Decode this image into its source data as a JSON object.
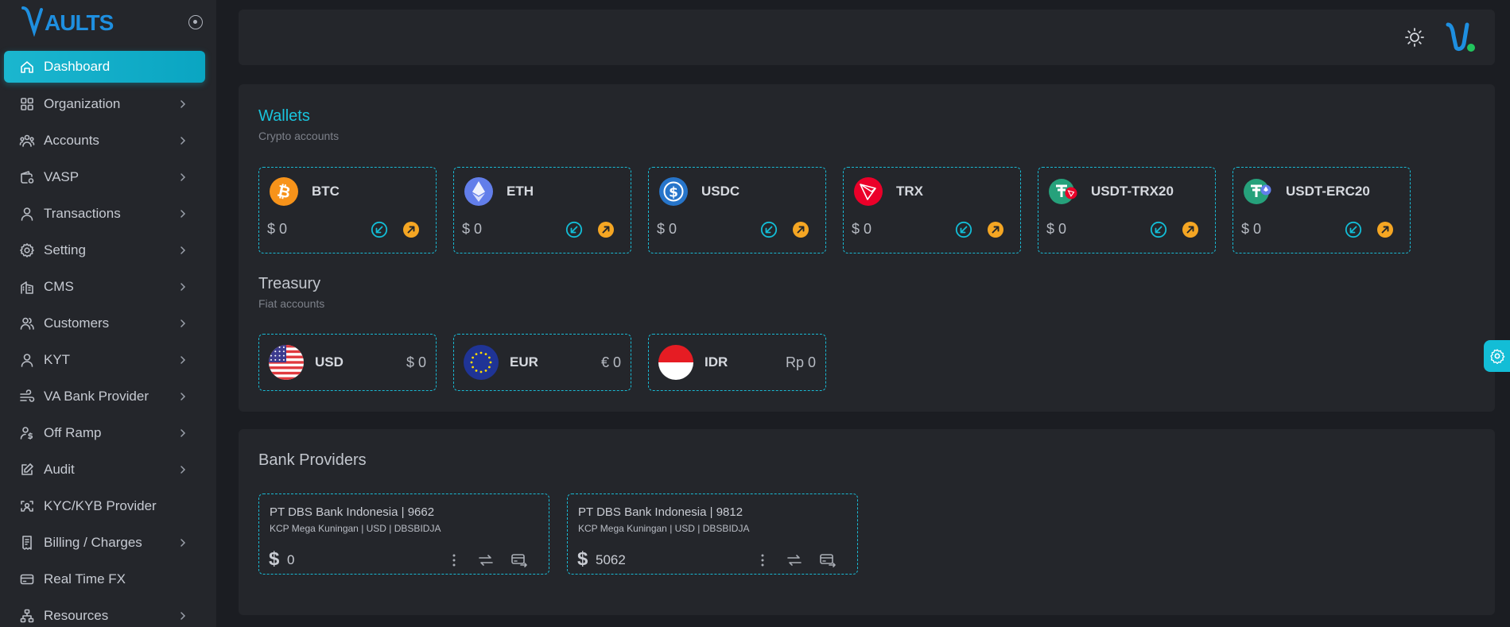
{
  "brand": {
    "logo_text": "VAULTS"
  },
  "sidebar": {
    "items": [
      {
        "label": "Dashboard",
        "icon": "home-icon",
        "active": true,
        "has_children": false
      },
      {
        "label": "Organization",
        "icon": "grid-icon",
        "has_children": true
      },
      {
        "label": "Accounts",
        "icon": "users-group-icon",
        "has_children": true
      },
      {
        "label": "VASP",
        "icon": "wallet-gear-icon",
        "has_children": true
      },
      {
        "label": "Transactions",
        "icon": "user-icon",
        "has_children": true
      },
      {
        "label": "Setting",
        "icon": "gear-icon",
        "has_children": true
      },
      {
        "label": "CMS",
        "icon": "building-icon",
        "has_children": true
      },
      {
        "label": "Customers",
        "icon": "users-icon",
        "has_children": true
      },
      {
        "label": "KYT",
        "icon": "user-outline-icon",
        "has_children": true
      },
      {
        "label": "VA Bank Provider",
        "icon": "wind-icon",
        "has_children": true
      },
      {
        "label": "Off Ramp",
        "icon": "user-dollar-icon",
        "has_children": true
      },
      {
        "label": "Audit",
        "icon": "edit-icon",
        "has_children": true
      },
      {
        "label": "KYC/KYB Provider",
        "icon": "face-scan-icon",
        "has_children": false
      },
      {
        "label": "Billing / Charges",
        "icon": "receipt-icon",
        "has_children": true
      },
      {
        "label": "Real Time FX",
        "icon": "credit-card-icon",
        "has_children": false
      },
      {
        "label": "Resources",
        "icon": "network-icon",
        "has_children": true
      }
    ]
  },
  "wallets": {
    "title": "Wallets",
    "subtitle": "Crypto accounts",
    "items": [
      {
        "symbol": "BTC",
        "amount": "$ 0",
        "icon": "btc-icon"
      },
      {
        "symbol": "ETH",
        "amount": "$ 0",
        "icon": "eth-icon"
      },
      {
        "symbol": "USDC",
        "amount": "$ 0",
        "icon": "usdc-icon"
      },
      {
        "symbol": "TRX",
        "amount": "$ 0",
        "icon": "trx-icon"
      },
      {
        "symbol": "USDT-TRX20",
        "amount": "$ 0",
        "icon": "usdt-trx20-icon"
      },
      {
        "symbol": "USDT-ERC20",
        "amount": "$ 0",
        "icon": "usdt-erc20-icon"
      }
    ]
  },
  "treasury": {
    "title": "Treasury",
    "subtitle": "Fiat accounts",
    "items": [
      {
        "symbol": "USD",
        "amount": "$ 0",
        "icon": "us-flag-icon"
      },
      {
        "symbol": "EUR",
        "amount": "€ 0",
        "icon": "eu-flag-icon"
      },
      {
        "symbol": "IDR",
        "amount": "Rp 0",
        "icon": "id-flag-icon"
      }
    ]
  },
  "banks": {
    "title": "Bank Providers",
    "items": [
      {
        "name": "PT DBS Bank Indonesia | 9662",
        "detail": "KCP Mega Kuningan | USD | DBSBIDJA",
        "currency_symbol": "$",
        "balance": "0"
      },
      {
        "name": "PT DBS Bank Indonesia | 9812",
        "detail": "KCP Mega Kuningan | USD | DBSBIDJA",
        "currency_symbol": "$",
        "balance": "5062"
      }
    ]
  },
  "colors": {
    "accent": "#13bdd6",
    "send": "#f5a623",
    "title_wallets": "#19c3dc",
    "background": "#1b1d22",
    "panel": "#24262b"
  }
}
